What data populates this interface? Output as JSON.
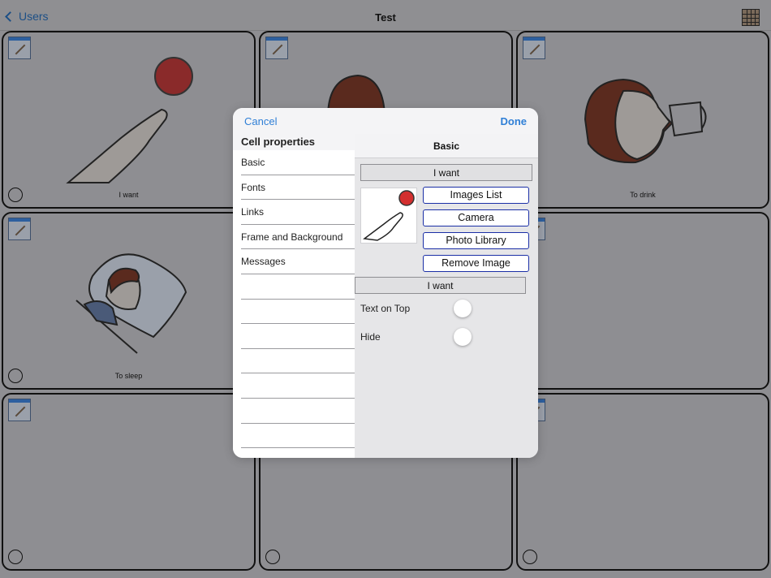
{
  "nav": {
    "back_label": "Users",
    "title": "Test"
  },
  "cells": [
    {
      "label": "I want"
    },
    {
      "label": ""
    },
    {
      "label": "To drink"
    },
    {
      "label": "To sleep"
    },
    {
      "label": ""
    },
    {
      "label": ""
    },
    {
      "label": ""
    },
    {
      "label": ""
    },
    {
      "label": ""
    }
  ],
  "modal": {
    "cancel_label": "Cancel",
    "done_label": "Done",
    "left_title": "Cell properties",
    "menu_items": [
      "Basic",
      "Fonts",
      "Links",
      "Frame and Background",
      "Messages",
      "",
      "",
      "",
      "",
      "",
      "",
      ""
    ],
    "right_title": "Basic",
    "top_text_value": "I want",
    "image_buttons": [
      "Images List",
      "Camera",
      "Photo Library",
      "Remove Image"
    ],
    "label_text_value": "I want",
    "toggles": [
      {
        "label": "Text on Top",
        "on": false
      },
      {
        "label": "Hide",
        "on": false
      }
    ]
  },
  "colors": {
    "accent": "#2f7fd6",
    "button_border": "#1b2fa6",
    "ball": "#c62828"
  }
}
